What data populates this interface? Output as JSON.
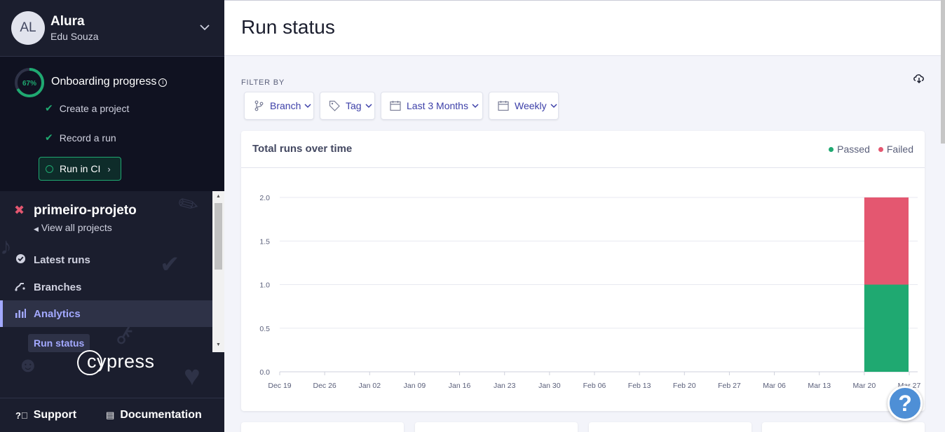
{
  "account": {
    "initials": "AL",
    "org_name": "Alura",
    "user_name": "Edu Souza"
  },
  "onboarding": {
    "percent_label": "67%",
    "percent": 0.67,
    "title": "Onboarding progress",
    "steps": [
      {
        "label": "Create a project",
        "done": true
      },
      {
        "label": "Record a run",
        "done": true
      }
    ],
    "cta_label": "Run in CI"
  },
  "project": {
    "name": "primeiro-projeto",
    "view_all_label": "View all projects"
  },
  "nav": {
    "latest_runs": "Latest runs",
    "branches": "Branches",
    "analytics": "Analytics",
    "run_status": "Run status"
  },
  "logo_text": "cypress",
  "footer": {
    "support": "Support",
    "documentation": "Documentation"
  },
  "page": {
    "title": "Run status"
  },
  "filters": {
    "heading": "FILTER BY",
    "branch": "Branch",
    "tag": "Tag",
    "range": "Last 3 Months",
    "interval": "Weekly"
  },
  "colors": {
    "passed": "#1fa971",
    "failed": "#e45770",
    "accent": "#3c3fa8",
    "sidebar": "#1b1e2e"
  },
  "help_label": "?",
  "chart_data": {
    "type": "bar",
    "title": "Total runs over time",
    "legend_position": "top-right",
    "categories": [
      "Dec 19",
      "Dec 26",
      "Jan 02",
      "Jan 09",
      "Jan 16",
      "Jan 23",
      "Jan 30",
      "Feb 06",
      "Feb 13",
      "Feb 20",
      "Feb 27",
      "Mar 06",
      "Mar 13",
      "Mar 20",
      "Mar 27"
    ],
    "yticks": [
      "0.0",
      "0.5",
      "1.0",
      "1.5",
      "2.0"
    ],
    "ylim": [
      0,
      2
    ],
    "stacked": true,
    "grid": true,
    "series": [
      {
        "name": "Passed",
        "values": [
          0,
          0,
          0,
          0,
          0,
          0,
          0,
          0,
          0,
          0,
          0,
          0,
          0,
          1,
          0
        ]
      },
      {
        "name": "Failed",
        "values": [
          0,
          0,
          0,
          0,
          0,
          0,
          0,
          0,
          0,
          0,
          0,
          0,
          0,
          1,
          0
        ]
      }
    ]
  }
}
